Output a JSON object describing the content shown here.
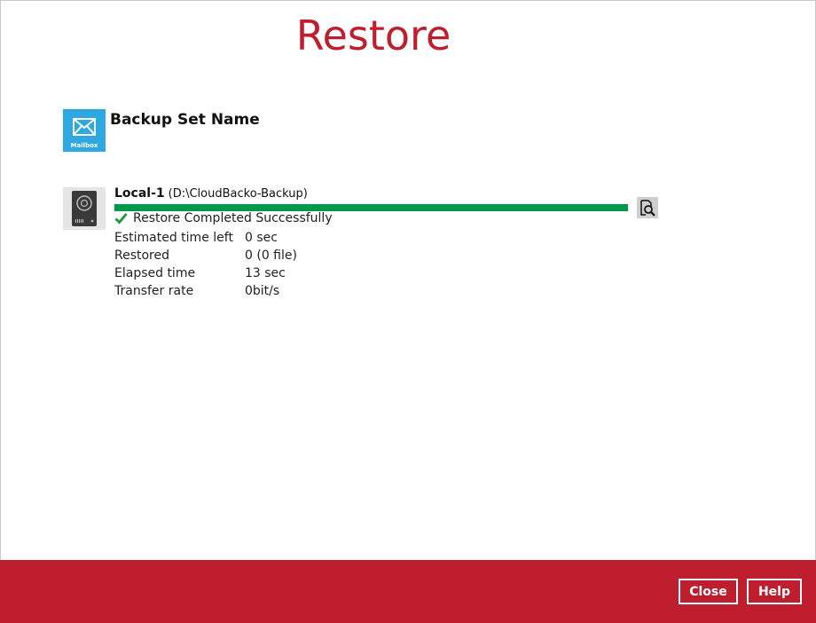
{
  "window": {
    "title": "Restore"
  },
  "backup_set": {
    "icon_name": "mailbox-icon",
    "icon_caption": "Mailbox",
    "label": "Backup Set Name"
  },
  "destination": {
    "icon_name": "hard-drive-icon",
    "name": "Local-1",
    "path": "(D:\\CloudBacko-Backup)",
    "progress_percent": 100,
    "status": "Restore Completed Successfully",
    "stats": [
      {
        "label": "Estimated time left",
        "value": "0 sec"
      },
      {
        "label": "Restored",
        "value": "0 (0 file)"
      },
      {
        "label": "Elapsed time",
        "value": "13 sec"
      },
      {
        "label": "Transfer rate",
        "value": "0bit/s"
      }
    ],
    "log_button_icon": "magnifier-icon"
  },
  "footer": {
    "close_label": "Close",
    "help_label": "Help"
  },
  "colors": {
    "accent": "#be1e2d",
    "progress": "#00994c",
    "mailbox_tile": "#2ea8e0"
  }
}
